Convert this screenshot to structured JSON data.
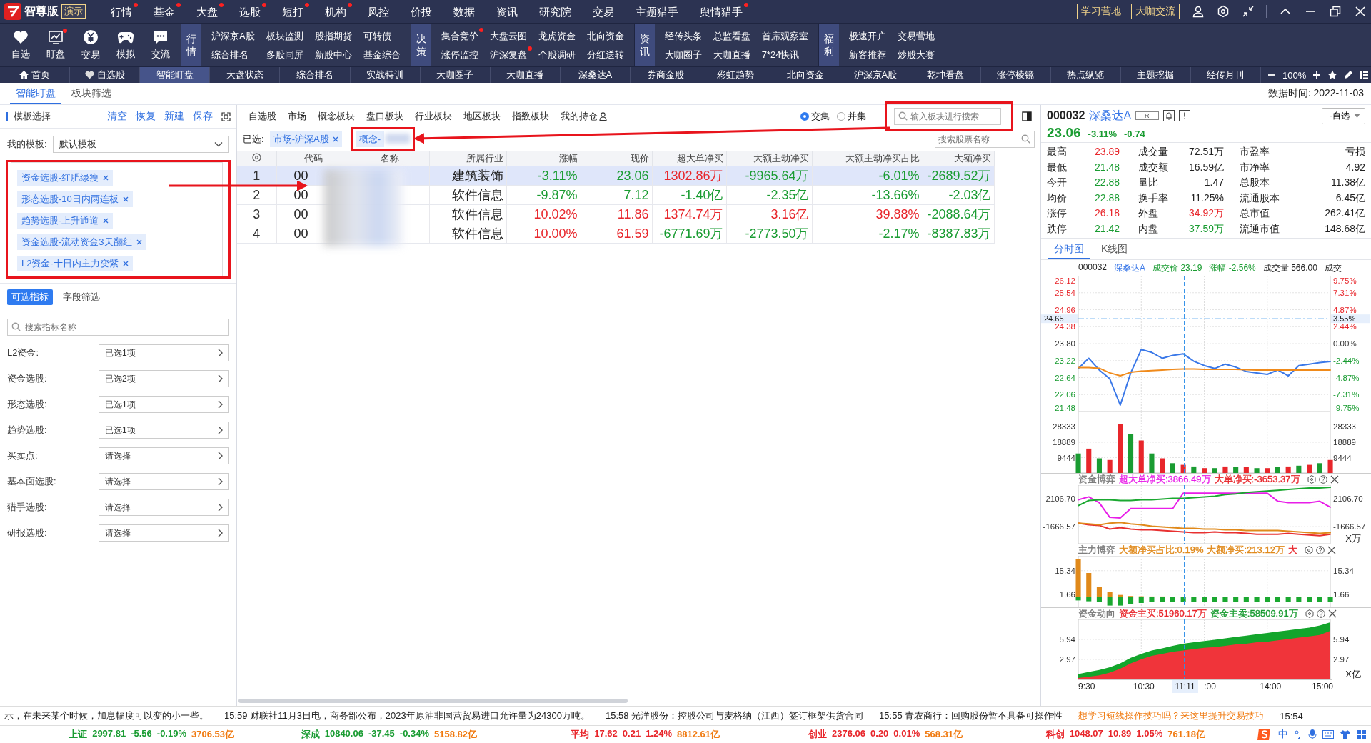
{
  "menu_bar": {
    "app_name": "智尊版",
    "badge": "演示",
    "items": [
      {
        "label": "行情",
        "dot": true
      },
      {
        "label": "基金",
        "dot": true
      },
      {
        "label": "大盘",
        "dot": true
      },
      {
        "label": "选股",
        "dot": true
      },
      {
        "label": "短打",
        "dot": true
      },
      {
        "label": "机构",
        "dot": true
      },
      {
        "label": "风控",
        "dot": false
      },
      {
        "label": "价投",
        "dot": false
      },
      {
        "label": "数据",
        "dot": false
      },
      {
        "label": "资讯",
        "dot": false
      },
      {
        "label": "研究院",
        "dot": false
      },
      {
        "label": "交易",
        "dot": false
      },
      {
        "label": "主题猎手",
        "dot": false
      },
      {
        "label": "舆情猎手",
        "dot": true
      }
    ],
    "buttons": [
      "学习营地",
      "大咖交流"
    ]
  },
  "toolbar": {
    "tools": [
      {
        "label": "自选",
        "kind": "heart",
        "dot": false
      },
      {
        "label": "盯盘",
        "kind": "chart",
        "dot": true
      },
      {
        "label": "交易",
        "kind": "yen",
        "dot": false
      },
      {
        "label": "模拟",
        "kind": "gamepad",
        "dot": false
      },
      {
        "label": "交流",
        "kind": "chat",
        "dot": false
      }
    ],
    "groups": [
      {
        "title": "行情",
        "rows": [
          [
            {
              "label": "沪深京A股",
              "dot": false
            },
            {
              "label": "板块监测",
              "dot": false
            },
            {
              "label": "股指期货",
              "dot": false
            },
            {
              "label": "可转债",
              "dot": false
            }
          ],
          [
            {
              "label": "综合排名",
              "dot": false
            },
            {
              "label": "多股同屏",
              "dot": false
            },
            {
              "label": "新股中心",
              "dot": false
            },
            {
              "label": "基金综合",
              "dot": false
            }
          ]
        ]
      },
      {
        "title": "决策",
        "rows": [
          [
            {
              "label": "集合竞价",
              "dot": true
            },
            {
              "label": "大盘云图",
              "dot": false
            },
            {
              "label": "龙虎资金",
              "dot": false
            },
            {
              "label": "北向资金",
              "dot": false
            }
          ],
          [
            {
              "label": "涨停监控",
              "dot": false
            },
            {
              "label": "沪深复盘",
              "dot": true
            },
            {
              "label": "个股调研",
              "dot": false
            },
            {
              "label": "分红送转",
              "dot": false
            }
          ]
        ]
      },
      {
        "title": "资讯",
        "rows": [
          [
            {
              "label": "经传头条",
              "dot": false
            },
            {
              "label": "总监看盘",
              "dot": false
            },
            {
              "label": "首席观察室",
              "dot": false
            }
          ],
          [
            {
              "label": "大咖圈子",
              "dot": false
            },
            {
              "label": "大咖直播",
              "dot": false
            },
            {
              "label": "7*24快讯",
              "dot": false
            }
          ]
        ]
      },
      {
        "title": "福利",
        "rows": [
          [
            {
              "label": "极速开户",
              "dot": false
            },
            {
              "label": "交易营地",
              "dot": false
            }
          ],
          [
            {
              "label": "新客推荐",
              "dot": false
            },
            {
              "label": "炒股大赛",
              "dot": false
            }
          ]
        ]
      }
    ]
  },
  "tabs": [
    {
      "label": "首页",
      "selected": false
    },
    {
      "label": "自选股",
      "selected": false
    },
    {
      "label": "智能盯盘",
      "selected": true
    },
    {
      "label": "大盘状态",
      "selected": false
    },
    {
      "label": "综合排名",
      "selected": false
    },
    {
      "label": "实战特训",
      "selected": false
    },
    {
      "label": "大咖圈子",
      "selected": false
    },
    {
      "label": "大咖直播",
      "selected": false
    },
    {
      "label": "深桑达A",
      "selected": false
    },
    {
      "label": "券商金股",
      "selected": false
    },
    {
      "label": "彩虹趋势",
      "selected": false
    },
    {
      "label": "北向资金",
      "selected": false
    },
    {
      "label": "沪深京A股",
      "selected": false
    },
    {
      "label": "乾坤看盘",
      "selected": false
    },
    {
      "label": "涨停棱镜",
      "selected": false
    },
    {
      "label": "热点纵览",
      "selected": false
    },
    {
      "label": "主题挖掘",
      "selected": false
    },
    {
      "label": "经传月刊",
      "selected": false
    }
  ],
  "zoom_text": "100%",
  "subtabs": [
    {
      "label": "智能盯盘",
      "selected": true
    },
    {
      "label": "板块筛选",
      "selected": false
    }
  ],
  "data_time": "数据时间: 2022-11-03",
  "left_panel": {
    "title": "模板选择",
    "actions": [
      "清空",
      "恢复",
      "新建",
      "保存"
    ],
    "template_label": "我的模板:",
    "template_value": "默认模板",
    "tags": [
      "资金选股-红肥绿瘦",
      "形态选股-10日内两连板",
      "趋势选股-上升通道",
      "资金选股-流动资金3天翻红",
      "L2资金-十日内主力变紫"
    ],
    "filter_tabs": [
      {
        "label": "可选指标",
        "selected": true
      },
      {
        "label": "字段筛选",
        "selected": false
      }
    ],
    "search": {
      "placeholder": "搜索指标名称"
    },
    "filters": [
      {
        "label": "L2资金:",
        "value": "已选1项"
      },
      {
        "label": "资金选股:",
        "value": "已选2项"
      },
      {
        "label": "形态选股:",
        "value": "已选1项"
      },
      {
        "label": "趋势选股:",
        "value": "已选1项"
      },
      {
        "label": "买卖点:",
        "value": "请选择"
      },
      {
        "label": "基本面选股:",
        "value": "请选择"
      },
      {
        "label": "猎手选股:",
        "value": "请选择"
      },
      {
        "label": "研报选股:",
        "value": "请选择"
      }
    ]
  },
  "center": {
    "categories": [
      {
        "label": "自选股"
      },
      {
        "label": "市场"
      },
      {
        "label": "概念板块"
      },
      {
        "label": "盘口板块"
      },
      {
        "label": "行业板块"
      },
      {
        "label": "地区板块"
      },
      {
        "label": "指数板块"
      },
      {
        "label": "我的持仓"
      }
    ],
    "match_modes": [
      {
        "label": "交集",
        "selected": true
      },
      {
        "label": "并集",
        "selected": false
      }
    ],
    "block_search": {
      "placeholder": "输入板块进行搜索"
    },
    "selected_label": "已选:",
    "selected_tags": [
      {
        "label": "市场-沪深A股",
        "kind": "removable"
      },
      {
        "label": "概念-",
        "kind": "obscured"
      }
    ],
    "stock_search": {
      "placeholder": "搜索股票名称"
    },
    "table": {
      "columns": [
        "代码",
        "名称",
        "所属行业",
        "涨幅",
        "现价",
        "超大单净买",
        "大额主动净买",
        "大额主动净买占比",
        "大额净买"
      ],
      "rows": [
        {
          "index": "1",
          "code": "00",
          "industry": "建筑装饰",
          "selected": true,
          "values": [
            {
              "text": "-3.11%",
              "color": "#1a9c32"
            },
            {
              "text": "23.06",
              "color": "#1a9c32"
            },
            {
              "text": "1302.86万",
              "color": "#e8262b"
            },
            {
              "text": "-9965.64万",
              "color": "#1a9c32"
            },
            {
              "text": "-6.01%",
              "color": "#1a9c32"
            },
            {
              "text": "-2689.52万",
              "color": "#1a9c32"
            }
          ]
        },
        {
          "index": "2",
          "code": "00",
          "industry": "软件信息",
          "selected": false,
          "values": [
            {
              "text": "-9.87%",
              "color": "#1a9c32"
            },
            {
              "text": "7.12",
              "color": "#1a9c32"
            },
            {
              "text": "-1.40亿",
              "color": "#1a9c32"
            },
            {
              "text": "-2.35亿",
              "color": "#1a9c32"
            },
            {
              "text": "-13.66%",
              "color": "#1a9c32"
            },
            {
              "text": "-2.03亿",
              "color": "#1a9c32"
            }
          ]
        },
        {
          "index": "3",
          "code": "00",
          "industry": "软件信息",
          "selected": false,
          "values": [
            {
              "text": "10.02%",
              "color": "#e8262b"
            },
            {
              "text": "11.86",
              "color": "#e8262b"
            },
            {
              "text": "1374.74万",
              "color": "#e8262b"
            },
            {
              "text": "3.16亿",
              "color": "#e8262b"
            },
            {
              "text": "39.88%",
              "color": "#e8262b"
            },
            {
              "text": "-2088.64万",
              "color": "#1a9c32"
            }
          ]
        },
        {
          "index": "4",
          "code": "00",
          "industry": "软件信息",
          "selected": false,
          "values": [
            {
              "text": "10.00%",
              "color": "#e8262b"
            },
            {
              "text": "61.59",
              "color": "#e8262b"
            },
            {
              "text": "-6771.69万",
              "color": "#1a9c32"
            },
            {
              "text": "-2773.50万",
              "color": "#1a9c32"
            },
            {
              "text": "-2.17%",
              "color": "#1a9c32"
            },
            {
              "text": "-8387.83万",
              "color": "#1a9c32"
            }
          ]
        }
      ]
    }
  },
  "quote": {
    "code": "000032",
    "name": "深桑达A",
    "tag": "R",
    "watch_button": "-自选",
    "price": {
      "last": "23.06",
      "pct": "-3.11%",
      "change": "-0.74",
      "color": "#1a9c32"
    },
    "stats": [
      {
        "label": "最高",
        "value": "23.89",
        "color": "#e8262b"
      },
      {
        "label": "成交量",
        "value": "72.51万",
        "color": "#222222"
      },
      {
        "label": "市盈率",
        "value": "亏损",
        "color": "#222222"
      },
      {
        "label": "最低",
        "value": "21.48",
        "color": "#1a9c32"
      },
      {
        "label": "成交额",
        "value": "16.59亿",
        "color": "#222222"
      },
      {
        "label": "市净率",
        "value": "4.92",
        "color": "#222222"
      },
      {
        "label": "今开",
        "value": "22.88",
        "color": "#1a9c32"
      },
      {
        "label": "量比",
        "value": "1.47",
        "color": "#222222"
      },
      {
        "label": "总股本",
        "value": "11.38亿",
        "color": "#222222"
      },
      {
        "label": "均价",
        "value": "22.88",
        "color": "#1a9c32"
      },
      {
        "label": "换手率",
        "value": "11.25%",
        "color": "#222222"
      },
      {
        "label": "流通股本",
        "value": "6.45亿",
        "color": "#222222"
      },
      {
        "label": "涨停",
        "value": "26.18",
        "color": "#e8262b"
      },
      {
        "label": "外盘",
        "value": "34.92万",
        "color": "#e8262b"
      },
      {
        "label": "总市值",
        "value": "262.41亿",
        "color": "#222222"
      },
      {
        "label": "跌停",
        "value": "21.42",
        "color": "#1a9c32"
      },
      {
        "label": "内盘",
        "value": "37.59万",
        "color": "#1a9c32"
      },
      {
        "label": "流通市值",
        "value": "148.68亿",
        "color": "#222222"
      }
    ],
    "chart_tabs": [
      {
        "label": "分时图",
        "selected": true
      },
      {
        "label": "K线图",
        "selected": false
      }
    ],
    "chart_info": [
      {
        "text": "000032",
        "color": "#222222"
      },
      {
        "text": "深桑达A",
        "color": "#3a78e8"
      },
      {
        "text": "成交价 23.19",
        "color": "#1a9c32"
      },
      {
        "text": "涨幅 -2.56%",
        "color": "#1a9c32"
      },
      {
        "text": "成交量 566.00",
        "color": "#222222"
      },
      {
        "text": "成交",
        "color": "#222222"
      }
    ],
    "crosshair": {
      "price": "24.65",
      "pct": "3.55%",
      "time": "11:11"
    },
    "panels": [
      {
        "kind": "price",
        "colored_ticks": true,
        "right_labels": [
          "9.75%",
          "7.31%",
          "4.87%",
          "2.44%",
          "0.00%",
          "-2.44%",
          "-4.87%",
          "-7.31%",
          "-9.75%"
        ],
        "chart_data": {
          "type": "line",
          "grid": true,
          "ylim": [
            21.48,
            26.12
          ],
          "yticks": [
            {
              "value": 26.12,
              "label": "26.12"
            },
            {
              "value": 25.54,
              "label": "25.54"
            },
            {
              "value": 24.96,
              "label": "24.96"
            },
            {
              "value": 24.38,
              "label": "24.38"
            },
            {
              "value": 23.8,
              "label": "23.80"
            },
            {
              "value": 23.22,
              "label": "23.22"
            },
            {
              "value": 22.64,
              "label": "22.64"
            },
            {
              "value": 22.06,
              "label": "22.06"
            },
            {
              "value": 21.48,
              "label": "21.48"
            }
          ],
          "series": [
            {
              "color": "#3a78e8",
              "values": [
                22.95,
                23.3,
                22.9,
                22.6,
                21.7,
                22.8,
                23.6,
                23.5,
                23.3,
                23.4,
                23.45,
                23.2,
                23.05,
                22.95,
                23.1,
                23.0,
                22.85,
                22.8,
                22.75,
                22.9,
                22.7,
                23.05,
                23.1,
                23.15,
                23.19
              ]
            },
            {
              "color": "#f08a1a",
              "values": [
                22.98,
                22.98,
                22.96,
                22.8,
                22.7,
                22.82,
                22.86,
                22.88,
                22.9,
                22.92,
                22.93,
                22.93,
                22.92,
                22.92,
                22.92,
                22.92,
                22.91,
                22.9,
                22.9,
                22.9,
                22.9,
                22.9,
                22.9,
                22.9,
                22.9
              ]
            }
          ]
        }
      },
      {
        "kind": "volume",
        "colored_ticks": false,
        "right_labels": [
          "28333",
          "18889",
          "9444"
        ],
        "chart_data": {
          "type": "bar",
          "grid": true,
          "ylim": [
            0,
            37777
          ],
          "yticks": [
            28333,
            18889,
            9444
          ],
          "series": [
            {
              "color": "#e8262b",
              "values": [
                null,
                15000,
                null,
                8000,
                30000,
                null,
                20000,
                null,
                9000,
                null,
                5000,
                null,
                3000,
                null,
                4000,
                null,
                3500,
                null,
                3000,
                null,
                4000,
                null,
                5000,
                null,
                8000
              ]
            },
            {
              "color": "#1a9c32",
              "values": [
                12000,
                null,
                9000,
                null,
                null,
                24000,
                null,
                12000,
                null,
                6000,
                null,
                4000,
                null,
                3000,
                null,
                3500,
                null,
                3000,
                null,
                3500,
                null,
                4500,
                null,
                6000,
                null
              ]
            }
          ]
        }
      },
      {
        "kind": "game",
        "colored_ticks": false,
        "legend": [
          {
            "text": "资金博弈",
            "color": "#777777"
          },
          {
            "text": "超大单净买:3866.49万",
            "color": "#e81ee8"
          },
          {
            "text": "大单净买:-3653.37万",
            "color": "#e8262b"
          }
        ],
        "right_labels": [
          "2106.70",
          "-1666.57"
        ],
        "unit": "X万",
        "chart_data": {
          "type": "line",
          "grid": true,
          "ylim": [
            -4000,
            4000
          ],
          "yticks": [
            {
              "value": 2106.7,
              "label": "2106.70"
            },
            {
              "value": -1666.57,
              "label": "-1666.57"
            }
          ],
          "series": [
            {
              "color": "#e81ee8",
              "values": [
                2000,
                2400,
                1600,
                -400,
                -500,
                800,
                800,
                800,
                800,
                800,
                2900,
                2900,
                2900,
                2900,
                2900,
                2900,
                2900,
                2900,
                2900,
                1800,
                1600,
                1600,
                1600,
                1800,
                1000
              ]
            },
            {
              "color": "#e83030",
              "values": [
                -1200,
                -1400,
                -1500,
                -2000,
                -1800,
                -2000,
                -2100,
                -2100,
                -2200,
                -2300,
                -2400,
                -2500,
                -2500,
                -2400,
                -2500,
                -2500,
                -2600,
                -2700,
                -2700,
                -2700,
                -2600,
                -2700,
                -2800,
                -2900,
                -2700
              ]
            },
            {
              "color": "#1aa830",
              "values": [
                1200,
                1900,
                2000,
                2000,
                1900,
                1900,
                2000,
                2000,
                2100,
                2200,
                2200,
                2300,
                2400,
                2500,
                2700,
                2800,
                3000,
                3100,
                3200,
                3300,
                3400,
                3500,
                3600,
                3600,
                3700
              ]
            },
            {
              "color": "#e0891a",
              "values": [
                -1200,
                -1300,
                -1400,
                -1200,
                -1100,
                -1300,
                -1400,
                -1600,
                -1700,
                -1800,
                -1900,
                -1900,
                -2000,
                -2000,
                -2100,
                -2100,
                -2200,
                -2200,
                -2200,
                -2200,
                -2300,
                -2400,
                -2500,
                -2600,
                -2500
              ]
            }
          ]
        }
      },
      {
        "kind": "main",
        "colored_ticks": false,
        "legend": [
          {
            "text": "主力博弈",
            "color": "#777777"
          },
          {
            "text": "大额净买占比:0.19%",
            "color": "#e0891a"
          },
          {
            "text": "大额净买:213.12万",
            "color": "#e0891a"
          },
          {
            "text": "大",
            "color": "#e8262b"
          }
        ],
        "right_labels": [
          "15.34",
          "1.66"
        ],
        "chart_data": {
          "type": "bar",
          "grid": true,
          "ylim": [
            -6,
            24
          ],
          "yticks": [
            {
              "value": 15.34,
              "label": "15.34"
            },
            {
              "value": 1.66,
              "label": "1.66"
            }
          ],
          "series": [
            {
              "color": "#e0891a",
              "values": [
                22,
                14,
                6,
                3,
                1.2,
                0.6,
                0.4,
                0.3,
                0.3,
                0.2,
                0.2,
                0.2,
                0.2,
                0.2,
                0.2,
                0.2,
                0.2,
                0.2,
                0.2,
                0.2,
                0.2,
                0.2,
                0.2,
                0.2,
                0.2
              ]
            },
            {
              "color": "#1aa830",
              "values": [
                -2,
                -2.5,
                -3,
                -5,
                -5,
                -4,
                -3.5,
                -3,
                -3,
                -3,
                -3,
                -3,
                -3,
                -3,
                -3,
                -3,
                -3,
                -3,
                -3,
                -3,
                -3,
                -3,
                -3,
                -3,
                -3
              ]
            }
          ]
        }
      },
      {
        "kind": "flow",
        "colored_ticks": false,
        "legend": [
          {
            "text": "资金动向",
            "color": "#777777"
          },
          {
            "text": "资金主买:51960.17万",
            "color": "#e8262b"
          },
          {
            "text": "资金主卖:58509.91万",
            "color": "#1a9c32"
          }
        ],
        "right_labels": [
          "5.94",
          "2.97"
        ],
        "unit": "X亿",
        "chart_data": {
          "type": "area",
          "grid": true,
          "ylim": [
            0,
            8.91
          ],
          "yticks": [
            {
              "value": 5.94,
              "label": "5.94"
            },
            {
              "value": 2.97,
              "label": "2.97"
            }
          ],
          "series": [
            {
              "color": "#13a52c",
              "values": [
                0.8,
                1.1,
                1.4,
                1.8,
                2.4,
                3.2,
                3.8,
                4.3,
                4.6,
                5.0,
                5.3,
                5.5,
                5.7,
                5.9,
                6.1,
                6.3,
                6.5,
                6.7,
                6.9,
                7.1,
                7.3,
                7.5,
                7.7,
                8.0,
                8.5
              ]
            },
            {
              "color": "#f0343a",
              "values": [
                0.2,
                0.4,
                0.6,
                1.0,
                1.6,
                2.4,
                3.0,
                3.5,
                3.8,
                4.1,
                4.3,
                4.5,
                4.7,
                4.8,
                5.0,
                5.2,
                5.3,
                5.5,
                5.6,
                5.8,
                6.0,
                6.2,
                6.4,
                6.6,
                7.2
              ]
            }
          ]
        }
      }
    ],
    "time_axis": [
      "9:30",
      "10:30",
      ":00",
      "14:00",
      "15:00"
    ]
  },
  "ticker": [
    {
      "text": "示，在未来某个时候，加息幅度可以变的小一些。",
      "color": "#222222"
    },
    {
      "text": "15:59 财联社11月3日电，商务部公布，2023年原油非国营贸易进口允许量为24300万吨。",
      "color": "#222222"
    },
    {
      "text": "15:58 光洋股份：控股公司与麦格纳（江西）签订框架供货合同",
      "color": "#222222"
    },
    {
      "text": "15:55 青农商行：回购股份暂不具备可操作性",
      "color": "#222222"
    },
    {
      "text": "想学习短线操作技巧吗？来这里提升交易技巧",
      "color": "#f07a10"
    },
    {
      "text": "15:54",
      "color": "#222222"
    }
  ],
  "indices": [
    {
      "name": "上证",
      "value": "2997.81",
      "change": "-5.56",
      "pct": "-0.19%",
      "amount": "3706.53亿",
      "color": "#1a9c32"
    },
    {
      "name": "深成",
      "value": "10840.06",
      "change": "-37.45",
      "pct": "-0.34%",
      "amount": "5158.82亿",
      "color": "#1a9c32"
    },
    {
      "name": "平均",
      "value": "17.62",
      "change": "0.21",
      "pct": "1.24%",
      "amount": "8812.61亿",
      "color": "#e8262b"
    },
    {
      "name": "创业",
      "value": "2376.06",
      "change": "0.20",
      "pct": "0.01%",
      "amount": "568.31亿",
      "color": "#e8262b"
    },
    {
      "name": "科创",
      "value": "1048.07",
      "change": "10.89",
      "pct": "1.05%",
      "amount": "761.18亿",
      "color": "#e8262b"
    }
  ],
  "ime_text": "中"
}
